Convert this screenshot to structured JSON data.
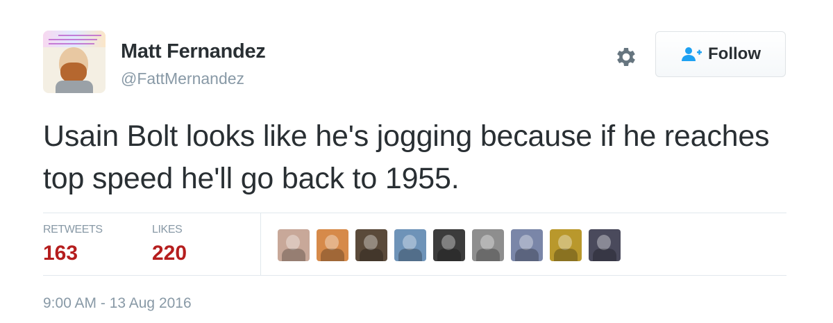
{
  "author": {
    "name": "Matt Fernandez",
    "handle": "@FattMernandez"
  },
  "actions": {
    "settings_icon": "gear-icon",
    "follow_label": "Follow",
    "follow_icon": "add-user-icon"
  },
  "tweet": {
    "text": "Usain Bolt looks like he's jogging because if he reaches top speed he'll go back to 1955."
  },
  "stats": {
    "retweets_label": "RETWEETS",
    "retweets_count": "163",
    "likes_label": "LIKES",
    "likes_count": "220"
  },
  "likers": [
    {
      "color": "#c8a899"
    },
    {
      "color": "#d68a4a"
    },
    {
      "color": "#5a4a3a"
    },
    {
      "color": "#6e93b8"
    },
    {
      "color": "#3c3c3c"
    },
    {
      "color": "#8e8e8e"
    },
    {
      "color": "#7a86a8"
    },
    {
      "color": "#b9982c"
    },
    {
      "color": "#4a4a5c"
    }
  ],
  "meta": {
    "timestamp": "9:00 AM - 13 Aug 2016"
  },
  "colors": {
    "stat_value": "#b51e1e",
    "muted": "#8899a6",
    "text": "#292f33",
    "follow_icon": "#1da1f2"
  }
}
